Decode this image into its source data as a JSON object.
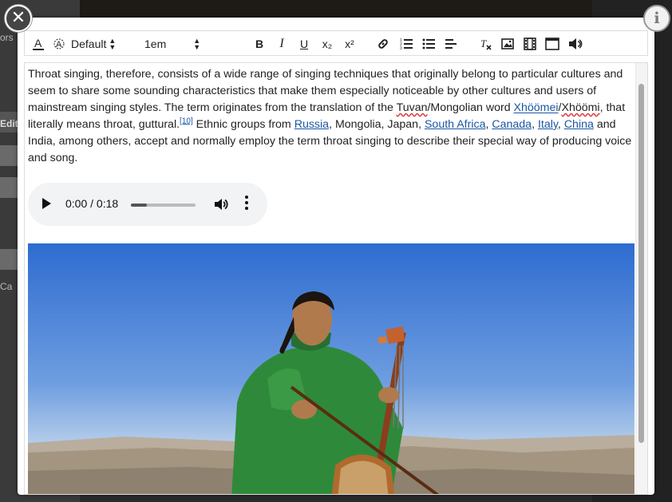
{
  "background": {
    "fragment_top": "ors",
    "fragment_mid": "Edit",
    "fragment_low": "Ca"
  },
  "modal": {
    "close_icon": "close-icon",
    "info_icon": "info-icon",
    "info_glyph": "i",
    "close_glyph": "✕"
  },
  "toolbar": {
    "font_select_value": "Default",
    "size_select_value": "1em",
    "bold": "B",
    "italic": "I",
    "underline": "U",
    "subscript": "x₂",
    "superscript": "x²"
  },
  "content": {
    "p1_a": "Throat singing, therefore, consists of a wide range of singing techniques that originally belong to particular cultures and seem to share some sounding characteristics that make them especially noticeable by other cultures and users of mainstream singing styles. The term originates from the translation of the ",
    "word_tuvan": "Tuvan",
    "p1_b": "/Mongolian word ",
    "link_xhoomei": "Xhöömei",
    "slash": "/",
    "word_xhoomi": "Xhöömi",
    "p1_c": ", that literally means throat, guttural.",
    "ref": "[10]",
    "p1_d": " Ethnic groups from ",
    "link_russia": "Russia",
    "p1_e": ", Mongolia, Japan, ",
    "link_south_africa": "South Africa",
    "comma1": ", ",
    "link_canada": "Canada",
    "comma2": ", ",
    "link_italy": "Italy",
    "comma3": ", ",
    "link_china": "China",
    "p1_f": " and India, among others, accept and normally employ the term throat singing to describe their special way of producing voice and song."
  },
  "audio": {
    "time_display": "0:00 / 0:18",
    "progress": 0.25
  },
  "colors": {
    "link": "#1a57a6",
    "coat": "#2e8a3a",
    "sky_top": "#2f6fd0",
    "sky_bottom": "#a9c6e6"
  }
}
